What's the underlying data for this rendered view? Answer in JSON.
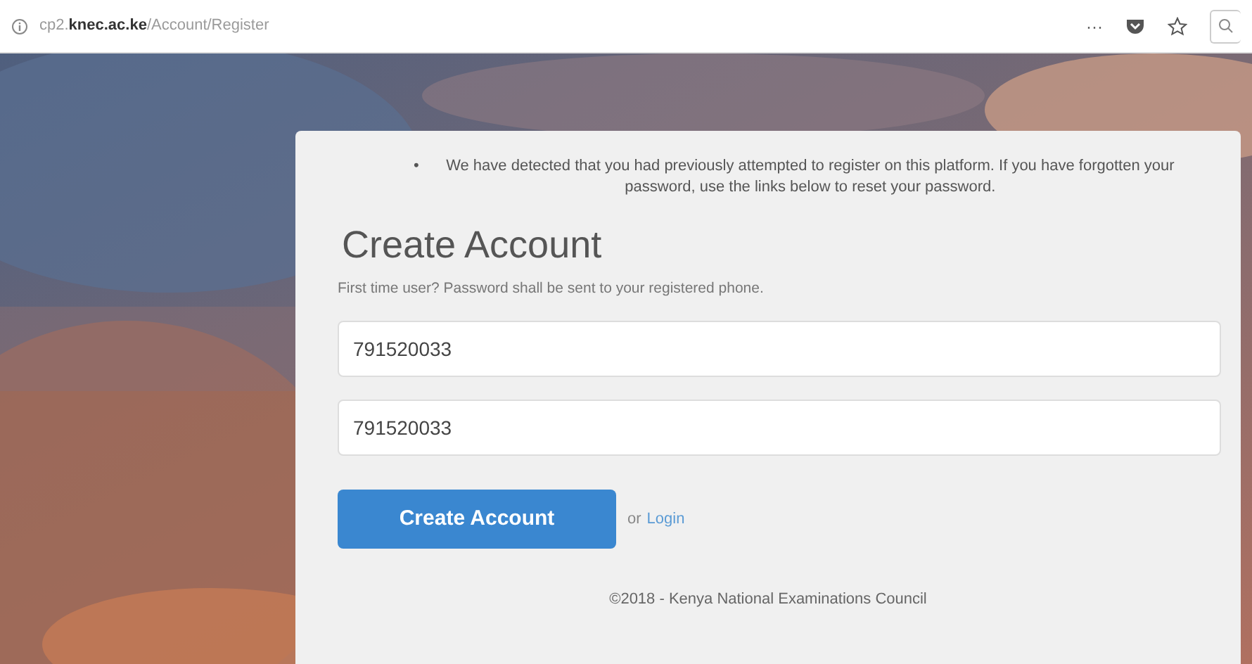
{
  "address_bar": {
    "url": "cp2.**knec.ac.ke**/Account/Register",
    "menu": "···"
  },
  "panel": {
    "notice_bullet": "•",
    "notices": [
      "We have detected that you had previously attempted to register on this platform. If you have forgotten your password, use the links below to reset your password."
    ],
    "title": "Create Account",
    "subtitle": "First time user? Password shall be sent to your registered phone.",
    "fields": [
      {
        "value": "791520033"
      },
      {
        "value": "791520033"
      }
    ],
    "button": "Create Account",
    "or": "or",
    "link": "Login",
    "footer": "©2018 - Kenya National Examinations Council"
  }
}
